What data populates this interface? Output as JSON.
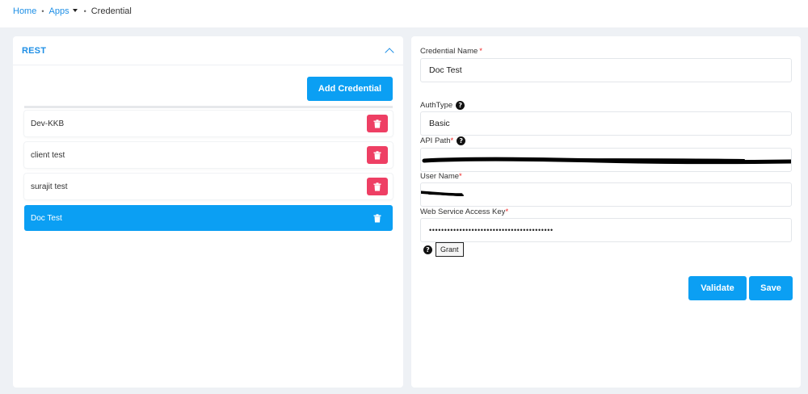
{
  "breadcrumb": {
    "home": "Home",
    "apps": "Apps",
    "current": "Credential"
  },
  "left_panel": {
    "title": "REST",
    "add_button": "Add Credential",
    "items": [
      {
        "label": "Dev-KKB",
        "active": false
      },
      {
        "label": "client test",
        "active": false
      },
      {
        "label": "surajit test",
        "active": false
      },
      {
        "label": "Doc Test",
        "active": true
      }
    ]
  },
  "form": {
    "credential_name_label": "Credential Name",
    "credential_name_value": "Doc Test",
    "auth_type_label": "AuthType",
    "auth_type_value": "Basic",
    "api_path_label": "API Path",
    "user_name_label": "User Name",
    "access_key_label": "Web Service Access Key",
    "access_key_value": "•••••••••••••••••••••••••••••••••••••••••",
    "grant_label": "Grant",
    "validate_label": "Validate",
    "save_label": "Save",
    "required_mark": "*"
  },
  "colors": {
    "accent": "#0b9ff3",
    "link": "#1e8fe6",
    "danger": "#ee3f64",
    "background": "#eef1f5"
  }
}
